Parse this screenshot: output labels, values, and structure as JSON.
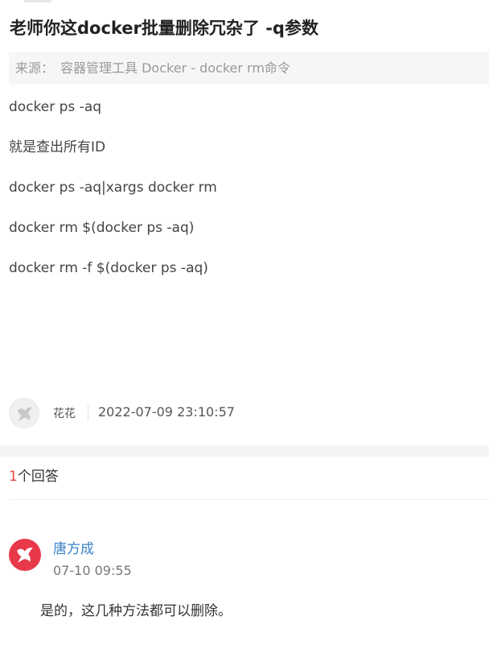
{
  "question": {
    "title": "老师你这docker批量删除冗杂了 -q参数",
    "source_label": "来源：",
    "source_value": "容器管理工具 Docker - docker rm命令",
    "lines": [
      "docker ps -aq",
      "就是查出所有ID",
      "docker ps -aq|xargs docker rm",
      "docker rm $(docker ps -aq)",
      "docker rm -f $(docker ps -aq)"
    ],
    "author": "花花",
    "time": "2022-07-09 23:10:57",
    "avatar_icon": "bird-logo-icon"
  },
  "answers": {
    "count": "1",
    "count_suffix": "个回答",
    "items": [
      {
        "author": "唐方成",
        "time": "07-10 09:55",
        "content": "是的，这几种方法都可以删除。",
        "avatar_icon": "bird-logo-icon"
      }
    ]
  },
  "colors": {
    "answer_count": "#e64545",
    "answer_author": "#3b82c8",
    "answer_avatar": "#e8394b",
    "source_background": "#f6f6f6"
  }
}
